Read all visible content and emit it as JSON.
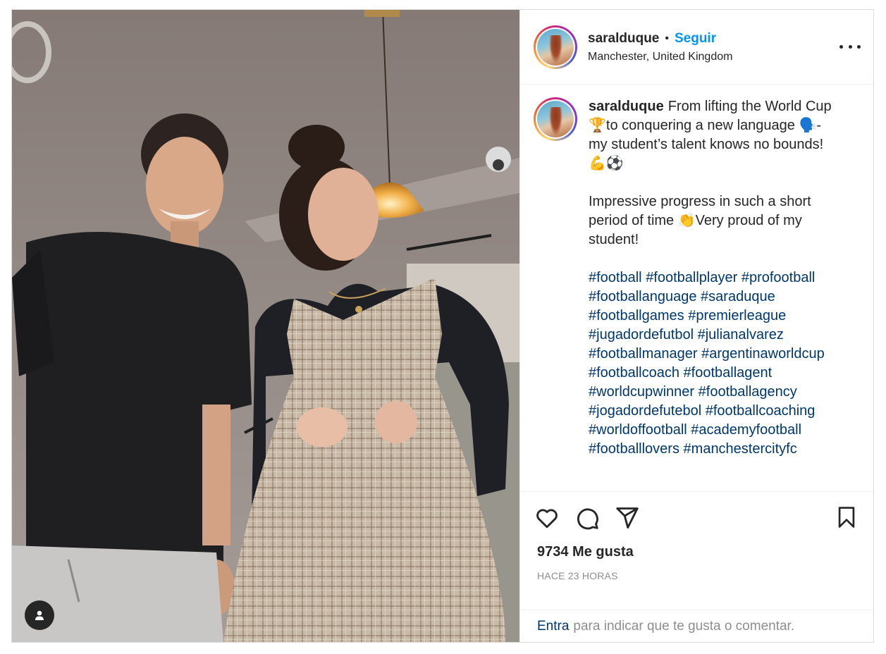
{
  "post": {
    "author": {
      "username": "saralduque",
      "follow_label": "Seguir",
      "separator": "•",
      "location": "Manchester, United Kingdom"
    },
    "caption": {
      "username": "saralduque",
      "line1": "From lifting the World Cup 🏆to conquering a new language 🗣️- my student’s talent knows no bounds! 💪⚽",
      "line2": "Impressive progress in such a short period of time 👏Very proud of my student!",
      "hashtags": [
        "#football",
        "#footballplayer",
        "#profootball",
        "#footballanguage",
        "#saraduque",
        "#footballgames",
        "#premierleague",
        "#jugadordefutbol",
        "#julianalvarez",
        "#footballmanager",
        "#argentinaworldcup",
        "#footballcoach",
        "#footballagent",
        "#worldcupwinner",
        "#footballagency",
        "#jogadordefutebol",
        "#footballcoaching",
        "#worldoffootball",
        "#academyfootball",
        "#footballlovers",
        "#manchestercityfc"
      ]
    },
    "likes": "9734 Me gusta",
    "timestamp": "HACE 23 HORAS",
    "footer": {
      "login_link": "Entra",
      "prompt": "para indicar que te gusta o comentar."
    },
    "icons": {
      "like": "heart-icon",
      "comment": "comment-icon",
      "share": "paper-plane-icon",
      "save": "bookmark-icon",
      "more": "more-options-icon",
      "tagged_users": "user-icon"
    },
    "colors": {
      "follow": "#0095f6",
      "hashtag": "#00376b",
      "muted": "#8e8e8e",
      "border": "#dbdbdb"
    }
  }
}
